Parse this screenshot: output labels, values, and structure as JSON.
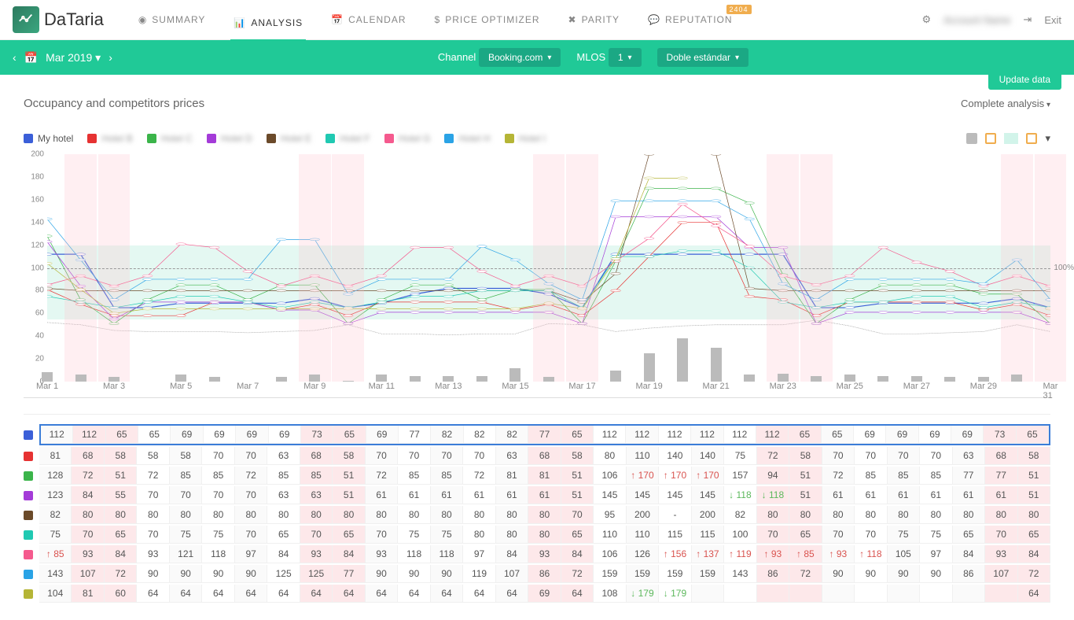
{
  "brand": "DaTaria",
  "nav": [
    {
      "label": "SUMMARY",
      "icon": "dashboard"
    },
    {
      "label": "ANALYSIS",
      "icon": "chart",
      "active": true
    },
    {
      "label": "CALENDAR",
      "icon": "calendar"
    },
    {
      "label": "PRICE OPTIMIZER",
      "icon": "dollar"
    },
    {
      "label": "PARITY",
      "icon": "x"
    },
    {
      "label": "REPUTATION",
      "icon": "speech",
      "badge": "2404"
    }
  ],
  "header_right": {
    "username": "Account Name",
    "exit": "Exit"
  },
  "subheader": {
    "date": "Mar 2019",
    "channel_label": "Channel",
    "channel_value": "Booking.com",
    "mlos_label": "MLOS",
    "mlos_value": "1",
    "roomtype": "Doble estándar"
  },
  "update_label": "Update data",
  "section_title": "Occupancy and competitors prices",
  "complete_analysis": "Complete analysis",
  "legend": [
    {
      "color": "#3b5fd8",
      "label": "My hotel",
      "blur": false
    },
    {
      "color": "#e63232",
      "label": "Hotel B",
      "blur": true
    },
    {
      "color": "#3bb44a",
      "label": "Hotel C",
      "blur": true
    },
    {
      "color": "#a43bd8",
      "label": "Hotel D",
      "blur": true
    },
    {
      "color": "#6b4a2a",
      "label": "Hotel E",
      "blur": true
    },
    {
      "color": "#20c9b2",
      "label": "Hotel F",
      "blur": true
    },
    {
      "color": "#f55a8e",
      "label": "Hotel G",
      "blur": true
    },
    {
      "color": "#2aa3e6",
      "label": "Hotel H",
      "blur": true
    },
    {
      "color": "#b5b536",
      "label": "Hotel I",
      "blur": true
    }
  ],
  "chart_data": {
    "type": "line",
    "x": [
      "Mar 1",
      "Mar 2",
      "Mar 3",
      "Mar 4",
      "Mar 5",
      "Mar 6",
      "Mar 7",
      "Mar 8",
      "Mar 9",
      "Mar 10",
      "Mar 11",
      "Mar 12",
      "Mar 13",
      "Mar 14",
      "Mar 15",
      "Mar 16",
      "Mar 17",
      "Mar 18",
      "Mar 19",
      "Mar 20",
      "Mar 21",
      "Mar 22",
      "Mar 23",
      "Mar 24",
      "Mar 25",
      "Mar 26",
      "Mar 27",
      "Mar 28",
      "Mar 29",
      "Mar 30",
      "Mar 31"
    ],
    "ylim": [
      0,
      200
    ],
    "y_ticks": [
      0,
      20,
      40,
      60,
      80,
      100,
      120,
      140,
      160,
      180,
      200
    ],
    "ref100_label": "100%",
    "ref0_label": "0%",
    "series": [
      {
        "name": "My hotel",
        "color": "#3b5fd8",
        "values": [
          112,
          112,
          65,
          65,
          69,
          69,
          69,
          69,
          73,
          65,
          69,
          77,
          82,
          82,
          82,
          77,
          65,
          112,
          112,
          112,
          112,
          112,
          112,
          65,
          65,
          69,
          69,
          69,
          69,
          73,
          65
        ]
      },
      {
        "name": "Hotel B",
        "color": "#e63232",
        "values": [
          81,
          68,
          58,
          58,
          58,
          70,
          70,
          63,
          68,
          58,
          70,
          70,
          70,
          70,
          63,
          68,
          58,
          80,
          110,
          140,
          140,
          75,
          72,
          58,
          70,
          70,
          70,
          70,
          63,
          68,
          58
        ]
      },
      {
        "name": "Hotel C",
        "color": "#3bb44a",
        "values": [
          128,
          72,
          51,
          72,
          85,
          85,
          72,
          85,
          85,
          51,
          72,
          85,
          85,
          72,
          81,
          81,
          51,
          106,
          170,
          170,
          170,
          157,
          94,
          51,
          72,
          85,
          85,
          85,
          77,
          77,
          51
        ]
      },
      {
        "name": "Hotel D",
        "color": "#a43bd8",
        "values": [
          123,
          84,
          55,
          70,
          70,
          70,
          70,
          63,
          63,
          51,
          61,
          61,
          61,
          61,
          61,
          61,
          51,
          145,
          145,
          145,
          145,
          118,
          118,
          51,
          61,
          61,
          61,
          61,
          61,
          61,
          51
        ]
      },
      {
        "name": "Hotel E",
        "color": "#6b4a2a",
        "values": [
          82,
          80,
          80,
          80,
          80,
          80,
          80,
          80,
          80,
          80,
          80,
          80,
          80,
          80,
          80,
          80,
          70,
          95,
          200,
          null,
          200,
          82,
          80,
          80,
          80,
          80,
          80,
          80,
          80,
          80,
          80
        ]
      },
      {
        "name": "Hotel F",
        "color": "#20c9b2",
        "values": [
          75,
          70,
          65,
          70,
          75,
          75,
          70,
          65,
          70,
          65,
          70,
          75,
          75,
          80,
          80,
          80,
          65,
          110,
          110,
          115,
          115,
          100,
          70,
          65,
          70,
          70,
          75,
          75,
          65,
          70,
          65
        ]
      },
      {
        "name": "Hotel G",
        "color": "#f55a8e",
        "values": [
          85,
          93,
          84,
          93,
          121,
          118,
          97,
          84,
          93,
          84,
          93,
          118,
          118,
          97,
          84,
          93,
          84,
          106,
          126,
          156,
          137,
          119,
          93,
          85,
          93,
          118,
          105,
          97,
          84,
          93,
          84
        ]
      },
      {
        "name": "Hotel H",
        "color": "#2aa3e6",
        "values": [
          143,
          107,
          72,
          90,
          90,
          90,
          90,
          125,
          125,
          77,
          90,
          90,
          90,
          119,
          107,
          86,
          72,
          159,
          159,
          159,
          159,
          143,
          86,
          72,
          90,
          90,
          90,
          90,
          86,
          107,
          72
        ]
      },
      {
        "name": "Hotel I",
        "color": "#b5b536",
        "values": [
          104,
          81,
          60,
          64,
          64,
          64,
          64,
          64,
          64,
          64,
          64,
          64,
          64,
          64,
          64,
          69,
          64,
          108,
          179,
          179,
          null,
          null,
          null,
          null,
          null,
          null,
          null,
          null,
          null,
          null,
          64
        ]
      }
    ],
    "occupancy_dashed": [
      52,
      50,
      45,
      44,
      44,
      44,
      43,
      44,
      45,
      50,
      42,
      42,
      41,
      42,
      42,
      51,
      50,
      44,
      47,
      49,
      50,
      50,
      50,
      54,
      49,
      42,
      42,
      43,
      44,
      50,
      44
    ],
    "bars": [
      8,
      6,
      4,
      0,
      6,
      4,
      0,
      4,
      6,
      1,
      6,
      5,
      5,
      5,
      12,
      4,
      0,
      10,
      25,
      38,
      30,
      6,
      7,
      5,
      6,
      5,
      5,
      4,
      4,
      6,
      0
    ],
    "weekend_cols": [
      1,
      2,
      8,
      9,
      15,
      16,
      22,
      23,
      29,
      30
    ],
    "band_values": {
      "low": 55,
      "high": 120
    }
  },
  "table": {
    "weekend_cols": [
      1,
      2,
      8,
      9,
      15,
      16,
      22,
      23,
      29,
      30
    ],
    "rows": [
      {
        "color": "#3b5fd8",
        "cells": [
          "112",
          "112",
          "65",
          "65",
          "69",
          "69",
          "69",
          "69",
          "73",
          "65",
          "69",
          "77",
          "82",
          "82",
          "82",
          "77",
          "65",
          "112",
          "112",
          "112",
          "112",
          "112",
          "112",
          "65",
          "65",
          "69",
          "69",
          "69",
          "69",
          "73",
          "65"
        ]
      },
      {
        "color": "#e63232",
        "cells": [
          "81",
          "68",
          "58",
          "58",
          "58",
          "70",
          "70",
          "63",
          "68",
          "58",
          "70",
          "70",
          "70",
          "70",
          "63",
          "68",
          "58",
          "80",
          "110",
          "140",
          "140",
          "75",
          "72",
          "58",
          "70",
          "70",
          "70",
          "70",
          "63",
          "68",
          "58"
        ]
      },
      {
        "color": "#3bb44a",
        "cells": [
          "128",
          "72",
          "51",
          "72",
          "85",
          "85",
          "72",
          "85",
          "85",
          "51",
          "72",
          "85",
          "85",
          "72",
          "81",
          "81",
          "51",
          "106",
          "↑170",
          "↑170",
          "↑170",
          "157",
          "94",
          "51",
          "72",
          "85",
          "85",
          "85",
          "77",
          "77",
          "51"
        ]
      },
      {
        "color": "#a43bd8",
        "cells": [
          "123",
          "84",
          "55",
          "70",
          "70",
          "70",
          "70",
          "63",
          "63",
          "51",
          "61",
          "61",
          "61",
          "61",
          "61",
          "61",
          "51",
          "145",
          "145",
          "145",
          "145",
          "↓118",
          "↓118",
          "51",
          "61",
          "61",
          "61",
          "61",
          "61",
          "61",
          "51"
        ]
      },
      {
        "color": "#6b4a2a",
        "cells": [
          "82",
          "80",
          "80",
          "80",
          "80",
          "80",
          "80",
          "80",
          "80",
          "80",
          "80",
          "80",
          "80",
          "80",
          "80",
          "80",
          "70",
          "95",
          "200",
          "-",
          "200",
          "82",
          "80",
          "80",
          "80",
          "80",
          "80",
          "80",
          "80",
          "80",
          "80"
        ]
      },
      {
        "color": "#20c9b2",
        "cells": [
          "75",
          "70",
          "65",
          "70",
          "75",
          "75",
          "70",
          "65",
          "70",
          "65",
          "70",
          "75",
          "75",
          "80",
          "80",
          "80",
          "65",
          "110",
          "110",
          "115",
          "115",
          "100",
          "70",
          "65",
          "70",
          "70",
          "75",
          "75",
          "65",
          "70",
          "65"
        ]
      },
      {
        "color": "#f55a8e",
        "cells": [
          "↑85",
          "93",
          "84",
          "93",
          "121",
          "118",
          "97",
          "84",
          "93",
          "84",
          "93",
          "118",
          "118",
          "97",
          "84",
          "93",
          "84",
          "106",
          "126",
          "↑156",
          "↑137",
          "↑119",
          "↑93",
          "↑85",
          "↑93",
          "↑118",
          "105",
          "97",
          "84",
          "93",
          "84"
        ]
      },
      {
        "color": "#2aa3e6",
        "cells": [
          "143",
          "107",
          "72",
          "90",
          "90",
          "90",
          "90",
          "125",
          "125",
          "77",
          "90",
          "90",
          "90",
          "119",
          "107",
          "86",
          "72",
          "159",
          "159",
          "159",
          "159",
          "143",
          "86",
          "72",
          "90",
          "90",
          "90",
          "90",
          "86",
          "107",
          "72"
        ]
      },
      {
        "color": "#b5b536",
        "cells": [
          "104",
          "81",
          "60",
          "64",
          "64",
          "64",
          "64",
          "64",
          "64",
          "64",
          "64",
          "64",
          "64",
          "64",
          "64",
          "69",
          "64",
          "108",
          "↓179",
          "↓179",
          "",
          "",
          "",
          "",
          "",
          "",
          "",
          "",
          "",
          "",
          "64"
        ]
      }
    ]
  }
}
